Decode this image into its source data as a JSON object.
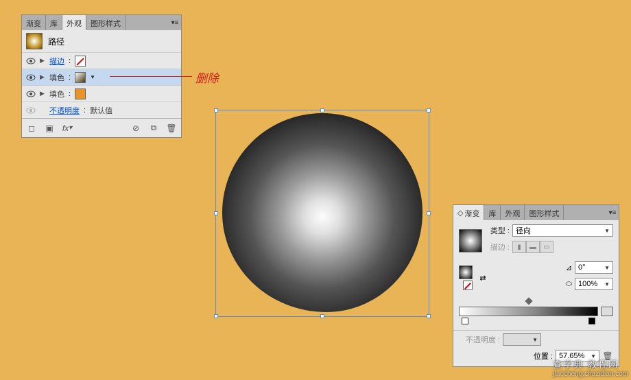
{
  "panel1": {
    "tabs": [
      "渐变",
      "库",
      "外观",
      "图形样式"
    ],
    "active_tab": "外观",
    "path_label": "路径",
    "rows": [
      {
        "label": "描边",
        "sep": " : "
      },
      {
        "label": "填色",
        "sep": " : "
      },
      {
        "label": "填色",
        "sep": " : "
      },
      {
        "label": "不透明度",
        "sep": " : ",
        "value": "默认值"
      }
    ]
  },
  "annotation": "删除",
  "panel2": {
    "tabs": [
      "渐变",
      "库",
      "外观",
      "图形样式"
    ],
    "active_tab": "渐变",
    "type_label": "类型 :",
    "type_value": "径向",
    "stroke_label": "描边 :",
    "angle_value": "0°",
    "aspect_value": "100%",
    "opacity_label": "不透明度 :",
    "position_label": "位置 :",
    "position_value": "57.65%"
  },
  "watermark": {
    "main": "查字典 教程网",
    "url": "jiaocheng.chazidian.com"
  }
}
